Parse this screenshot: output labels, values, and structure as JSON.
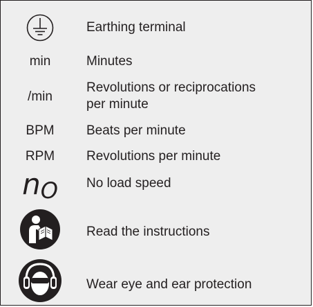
{
  "rows": [
    {
      "symbol_icon": "earthing-terminal-icon",
      "label": "Earthing terminal"
    },
    {
      "symbol": "min",
      "label": "Minutes"
    },
    {
      "symbol": "/min",
      "label_line1": "Revolutions or reciprocations",
      "label_line2": "per minute"
    },
    {
      "symbol": "BPM",
      "label": "Beats per minute"
    },
    {
      "symbol": "RPM",
      "label": "Revolutions per minute"
    },
    {
      "symbol_main": "n",
      "symbol_sub": "O",
      "label": "No load speed"
    },
    {
      "symbol_icon": "read-instructions-icon",
      "label": "Read the instructions"
    },
    {
      "symbol_icon": "eye-ear-protection-icon",
      "label": "Wear eye and ear protection"
    }
  ],
  "colors": {
    "background": "#eeeeee",
    "ink": "#231f20"
  }
}
